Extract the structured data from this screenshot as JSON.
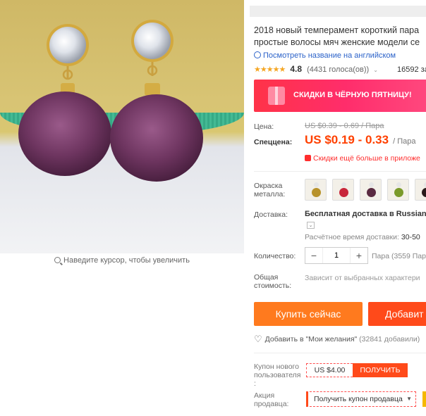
{
  "image": {
    "zoom_hint": "Наведите курсор, чтобы увеличить"
  },
  "product": {
    "title_line1": "2018 новый темперамент короткий пара",
    "title_line2": "простые волосы мяч женские модели се",
    "translate_link": "Посмотреть название на английском",
    "stars": "★★★★★",
    "rating": "4.8",
    "votes": "(4431 голоса(ов))",
    "orders": "16592 зак"
  },
  "banner": {
    "text": "СКИДКИ В ЧЁРНУЮ ПЯТНИЦУ!"
  },
  "price": {
    "label": "Цена:",
    "old": "US $0.39 - 0.69 / Пара",
    "special_label": "Спеццена:",
    "new": "US $0.19 - 0.33",
    "unit": "/ Пара",
    "promo_note": "Скидки ещё больше в приложе"
  },
  "color": {
    "label_line1": "Окраска",
    "label_line2": "металла:",
    "swatch_colors": [
      "#b8922a",
      "#c8263a",
      "#5a2a40",
      "#7a9a2a",
      "#2a1a1a"
    ]
  },
  "shipping": {
    "label": "Доставка:",
    "method": "Бесплатная доставка в Russian F",
    "eta_label": "Расчётное время доставки:",
    "eta_days": "30-50"
  },
  "quantity": {
    "label": "Количество:",
    "minus": "−",
    "value": "1",
    "plus": "+",
    "note": "Пара (3559 Пара"
  },
  "total": {
    "label_line1": "Общая",
    "label_line2": "стоимость:",
    "note": "Зависит от выбранных характери"
  },
  "actions": {
    "buy": "Купить сейчас",
    "cart": "Добавит",
    "wishlist": "Добавить в \"Мои желания\"",
    "wishlist_count": "(32841 добавили)"
  },
  "coupon": {
    "label_line1": "Купон нового",
    "label_line2": "пользователя",
    "label_line3": ":",
    "value": "US $4.00",
    "get": "ПОЛУЧИТЬ"
  },
  "seller": {
    "label_line1": "Акция",
    "label_line2": "продавца:",
    "coupon": "Получить купон продавца"
  }
}
